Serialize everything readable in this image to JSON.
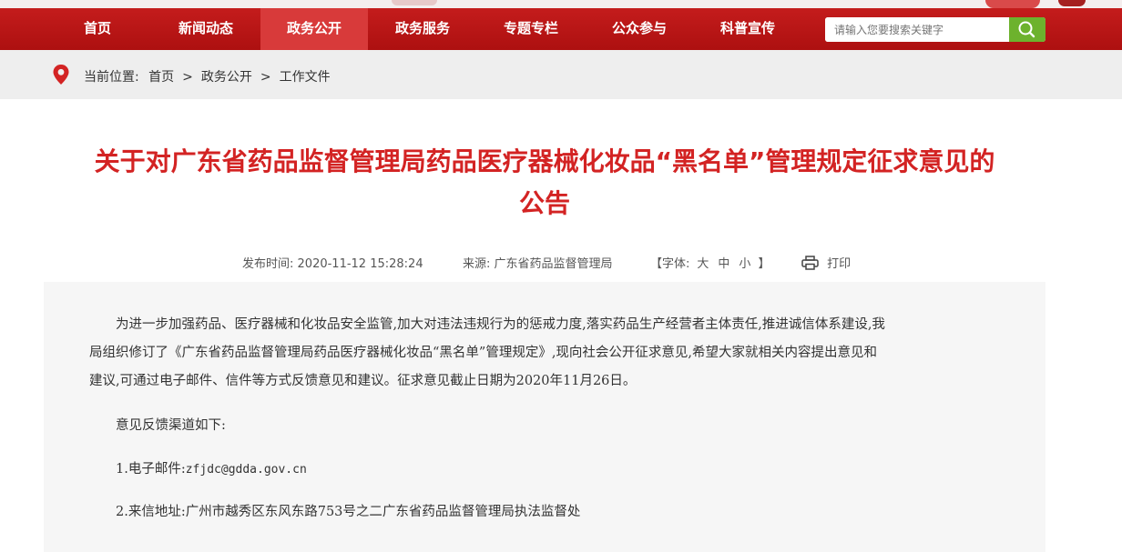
{
  "nav": {
    "items": [
      {
        "label": "首页"
      },
      {
        "label": "新闻动态"
      },
      {
        "label": "政务公开"
      },
      {
        "label": "政务服务"
      },
      {
        "label": "专题专栏"
      },
      {
        "label": "公众参与"
      },
      {
        "label": "科普宣传"
      }
    ],
    "active_index": 2,
    "search_placeholder": "请输入您要搜索关键字"
  },
  "breadcrumb": {
    "prefix": "当前位置:",
    "items": [
      "首页",
      "政务公开",
      "工作文件"
    ],
    "separator": ">"
  },
  "article": {
    "title_line1": "关于对广东省药品监督管理局药品医疗器械化妆品“黑名单”管理规定征求意见的",
    "title_line2": "公告",
    "publish_label": "发布时间:",
    "publish_time": "2020-11-12 15:28:24",
    "source_label": "来源:",
    "source": "广东省药品监督管理局",
    "font_open": "【字体:",
    "font_large": "大",
    "font_medium": "中",
    "font_small": "小",
    "font_close": "】",
    "print_label": "打印",
    "para1_line1": "为进一步加强药品、医疗器械和化妆品安全监管,加大对违法违规行为的惩戒力度,落实药品生产经营者主体责任,推进诚信体系建设,我",
    "para1_line2": "局组织修订了《广东省药品监督管理局药品医疗器械化妆品“黑名单”管理规定》,现向社会公开征求意见,希望大家就相关内容提出意见和",
    "para1_line3": "建议,可通过电子邮件、信件等方式反馈意见和建议。征求意见截止日期为2020年11月26日。",
    "para2": "意见反馈渠道如下:",
    "para3_label": "1.电子邮件:",
    "para3_email": "zfjdc@gdda.gov.cn",
    "para4": "2.来信地址:广州市越秀区东风东路753号之二广东省药品监督管理局执法监督处"
  },
  "colors": {
    "nav_bg": "#b51414",
    "nav_active": "#d83a3a",
    "title": "#d32323",
    "search_button": "#6db22d"
  },
  "icons": [
    "search-icon",
    "location-pin-icon",
    "printer-icon"
  ]
}
